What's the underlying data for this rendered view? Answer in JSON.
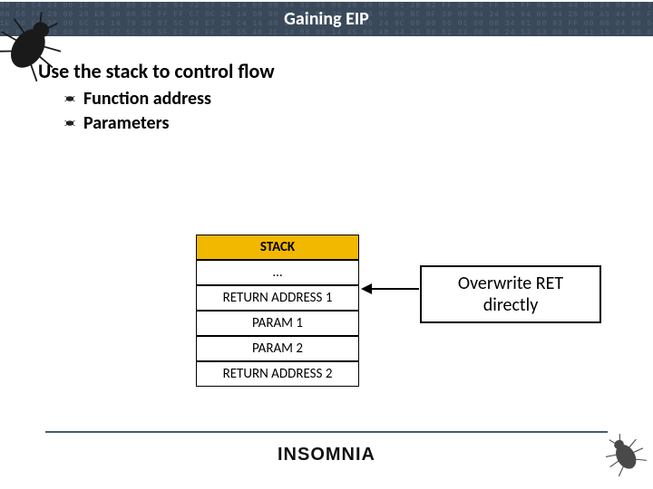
{
  "title": "Gaining EIP",
  "hex_filler": "00 08 C4 24 00 1C 00 08 90 93 20 04 72 C7 84 14 08 00 34 32 30 09 20 30 00 01 28 02 FF 20 02 FF 51 FF 8E 51 44 DC 24 00 E9 73 54 FF 55 44 53 00 00 84 10 64 24 30 01\n08 50 FF 29 00 20 EB 30 00 5C FF FF C7 0C 24 14 08 00 14 70 00 30 20 00 0C 00 BC 8F 30 00 04 24 54 64 00 44 20 00 A5 44 FF FF B5 40 00 A5 24 9E 00 00 10 11 00 00 11\n1E 00 EB 30 00 5C 14 14 70 30 07 5C 04 E7 28 C4 14 08 00 00 48 43 00 A5 24 9C 00 00 50 01 00 08 34 01 00 83 FF 00 00 04 08 50 11 10 08 4F 10\n1F 00 C9 90 00 00 51 F7 5C 59 5F EC FF FF 0C 55 40 2C 14 08 00 14 45 00 48 44 13 00 51 33 00 08 24 53 53 00 00 11 10 14 00 04 00 10",
  "body": {
    "main": "Use the stack to control flow",
    "bullets": [
      {
        "label": "Function address"
      },
      {
        "label": "Parameters"
      }
    ]
  },
  "stack": {
    "header": "STACK",
    "rows": [
      "…",
      "RETURN ADDRESS 1",
      "PARAM 1",
      "PARAM 2",
      "RETURN ADDRESS 2"
    ]
  },
  "callout": {
    "line1": "Overwrite RET",
    "line2": "directly"
  },
  "footer": {
    "brand": "INSOMNIA"
  }
}
